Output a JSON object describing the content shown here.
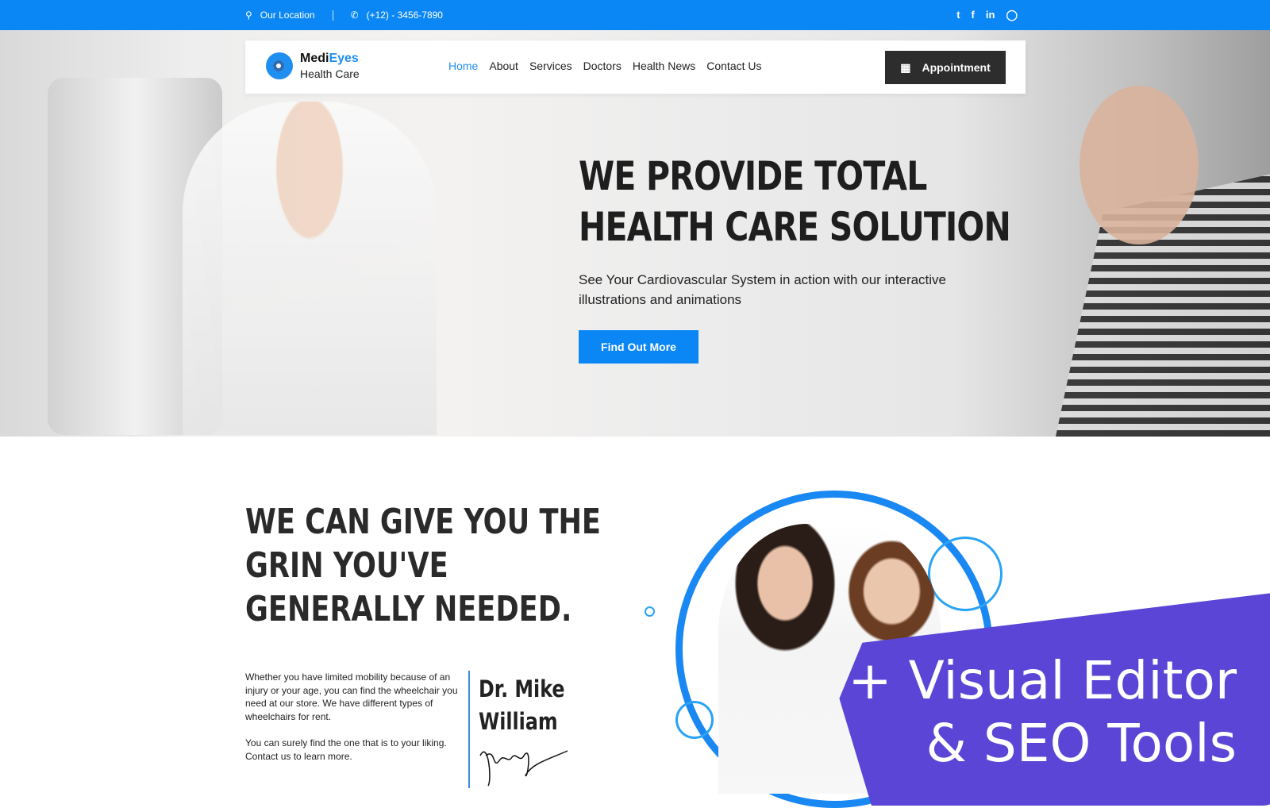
{
  "topbar": {
    "location": "Our Location",
    "phone": "(+12) - 3456-7890",
    "social": [
      "twitter-icon",
      "facebook-icon",
      "linkedin-icon",
      "instagram-icon"
    ]
  },
  "brand": {
    "name_part1": "Medi",
    "name_part2": "Eyes",
    "tagline": "Health Care"
  },
  "nav": {
    "items": [
      {
        "label": "Home",
        "active": true
      },
      {
        "label": "About"
      },
      {
        "label": "Services"
      },
      {
        "label": "Doctors"
      },
      {
        "label": "Health News"
      },
      {
        "label": "Contact Us"
      }
    ],
    "appointment_label": "Appointment"
  },
  "hero": {
    "title_line1": "WE PROVIDE TOTAL",
    "title_line2": "HEALTH CARE SOLUTION",
    "subtitle": "See Your Cardiovascular System in action with our interactive illustrations and animations",
    "button_label": "Find Out More"
  },
  "about": {
    "title": "WE CAN GIVE YOU THE GRIN YOU'VE GENERALLY NEEDED.",
    "paragraph1": "Whether you have limited mobility because of an injury or your age, you can find the wheelchair you need at our store. We have different types of wheelchairs for rent.",
    "paragraph2": "You can surely find the one that is to your liking. Contact us to learn more.",
    "doctor_line1": "Dr. Mike",
    "doctor_line2": "William"
  },
  "promo": {
    "line1": "+ Visual Editor",
    "line2": "& SEO Tools"
  },
  "colors": {
    "accent": "#0a87f5",
    "dark": "#2d2d2d",
    "promo": "#5a45d6"
  }
}
